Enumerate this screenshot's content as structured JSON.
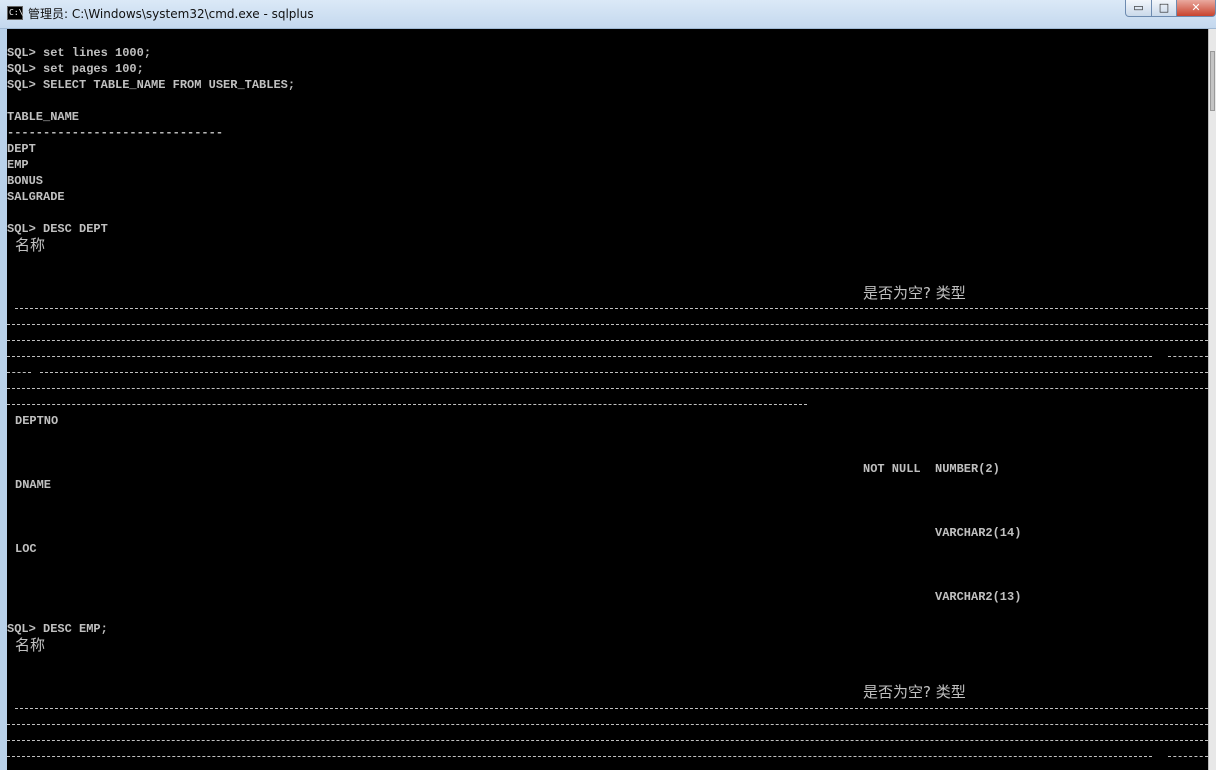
{
  "window": {
    "title": "管理员: C:\\Windows\\system32\\cmd.exe - sqlplus",
    "icon": "cmd-icon",
    "controls": {
      "minimize": "▭",
      "maximize": "□",
      "close": "✕"
    }
  },
  "console": {
    "cmd1": "SQL> set lines 1000;",
    "cmd2": "SQL> set pages 100;",
    "cmd3": "SQL> SELECT TABLE_NAME FROM USER_TABLES;",
    "col_header": "TABLE_NAME",
    "col_underline": "------------------------------",
    "tables": [
      "DEPT",
      "EMP",
      "BONUS",
      "SALGRADE"
    ],
    "cmd4": "SQL> DESC DEPT",
    "desc_name_header": "名称",
    "desc_null_type_header": "是否为空? 类型",
    "dept_rows": [
      {
        "name": "DEPTNO",
        "nullable": "NOT NULL",
        "type": "NUMBER(2)"
      },
      {
        "name": "DNAME",
        "nullable": "",
        "type": "VARCHAR2(14)"
      },
      {
        "name": "LOC",
        "nullable": "",
        "type": "VARCHAR2(13)"
      }
    ],
    "cmd5": "SQL> DESC EMP;"
  }
}
